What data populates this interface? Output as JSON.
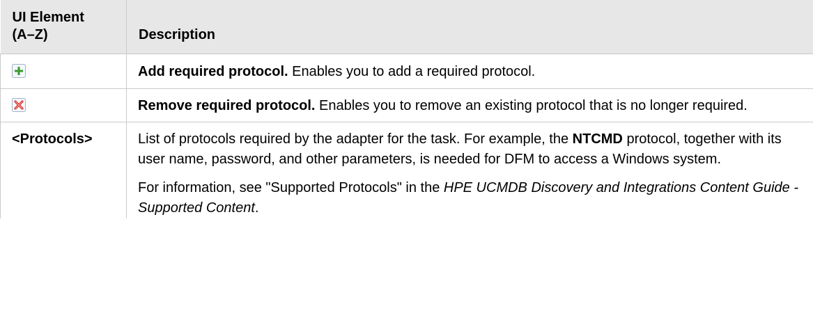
{
  "header": {
    "col1_line1": "UI Element",
    "col1_line2": "(A–Z)",
    "col2": "Description"
  },
  "rows": [
    {
      "icon": "add-green-plus-icon",
      "title": "Add required protocol.",
      "text": " Enables you to add a required protocol."
    },
    {
      "icon": "remove-red-x-icon",
      "title": "Remove required protocol.",
      "text": " Enables you to remove an existing protocol that is no longer required."
    },
    {
      "element": "<Protocols>",
      "p1_a": "List of protocols required by the adapter for the task. For example, the ",
      "p1_bold": "NTCMD",
      "p1_b": " protocol, together with its user name, password, and other parameters, is needed for DFM to access a Windows system.",
      "p2_a": "For information, see \"Supported Protocols\" in the ",
      "p2_italic": "HPE UCMDB Discovery and Integrations Content Guide - Supported Content",
      "p2_b": "."
    }
  ],
  "colors": {
    "header_bg": "#e7e7e7",
    "border": "#c9c9c9",
    "add_icon_green": "#3a9b2f",
    "remove_icon_red": "#d9302b"
  }
}
